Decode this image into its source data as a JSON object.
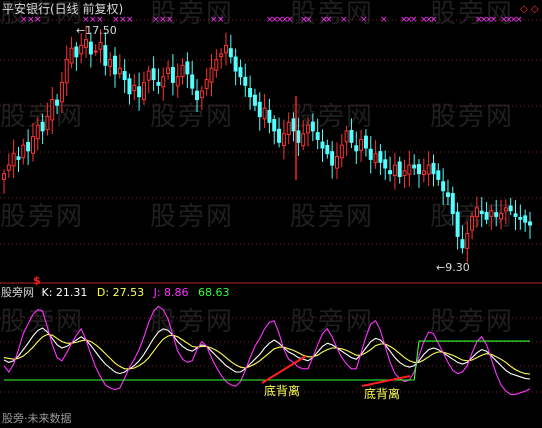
{
  "header": {
    "title": "平安银行(日线 前复权)",
    "title_color": "#d8d8d8"
  },
  "watermark": {
    "text": "股旁网",
    "color": "#3a3a3a"
  },
  "price_annotations": {
    "high": {
      "text": "17.50",
      "color": "#d8d8d8"
    },
    "low": {
      "text": "9.30",
      "color": "#d8d8d8"
    },
    "signal_marker": {
      "text": "$",
      "color": "#ff2020"
    }
  },
  "indicator": {
    "name": "股旁网",
    "k_label": "K: 21.31",
    "d_label": "D: 27.53",
    "j_label": "J: 8.86",
    "extra_label": "68.63",
    "colors": {
      "k": "#ffffff",
      "d": "#ffff55",
      "j": "#ff33ff",
      "extra": "#33ff33"
    }
  },
  "annotations": [
    {
      "text": "底背离",
      "color": "#ffff55"
    },
    {
      "text": "底背离",
      "color": "#ffff55"
    }
  ],
  "footer": {
    "text": "股旁·未来数据",
    "color": "#9a9a9a"
  },
  "chart_data": [
    {
      "type": "candlestick",
      "title": "平安银行(日线 前复权)",
      "xlabel": "",
      "ylabel": "",
      "high_label": 17.5,
      "low_label": 9.3,
      "ylim": [
        8.8,
        18.2
      ],
      "grid": true,
      "up_color": "#ff3333",
      "down_color": "#54ffff",
      "closes": [
        12.6,
        12.9,
        13.3,
        13.1,
        13.6,
        13.4,
        13.9,
        14.3,
        14.1,
        14.6,
        15.2,
        15.0,
        15.8,
        16.6,
        17.0,
        16.7,
        17.1,
        17.3,
        16.8,
        16.9,
        17.2,
        16.4,
        16.6,
        16.1,
        16.3,
        15.9,
        15.4,
        15.7,
        15.3,
        15.8,
        16.2,
        15.9,
        15.7,
        16.0,
        16.3,
        15.8,
        16.0,
        16.4,
        16.1,
        15.6,
        15.2,
        15.5,
        15.9,
        16.3,
        16.6,
        16.8,
        17.1,
        16.7,
        16.2,
        16.0,
        15.7,
        15.3,
        15.0,
        14.6,
        14.9,
        14.4,
        14.1,
        13.7,
        14.0,
        14.4,
        14.1,
        13.7,
        14.0,
        14.3,
        14.1,
        13.8,
        13.5,
        13.3,
        12.9,
        13.2,
        13.6,
        14.1,
        13.7,
        13.4,
        13.8,
        13.5,
        13.1,
        13.3,
        13.0,
        12.8,
        12.6,
        12.9,
        12.5,
        12.7,
        12.9,
        12.8,
        12.6,
        12.7,
        12.9,
        12.6,
        12.4,
        12.0,
        11.8,
        11.2,
        10.4,
        10.0,
        10.5,
        11.1,
        11.4,
        11.2,
        11.0,
        11.3,
        11.1,
        11.2,
        11.4,
        11.3,
        11.1,
        11.0,
        10.9,
        10.8
      ],
      "signal_marker_text": "$"
    },
    {
      "type": "line",
      "title": "股旁网",
      "xlabel": "",
      "ylabel": "",
      "ylim": [
        -20,
        120
      ],
      "series": [
        {
          "name": "K",
          "color": "#ffffff",
          "values": [
            45,
            42,
            44,
            50,
            58,
            66,
            75,
            82,
            85,
            80,
            72,
            64,
            60,
            62,
            66,
            70,
            74,
            70,
            63,
            55,
            47,
            40,
            35,
            30,
            28,
            30,
            34,
            38,
            44,
            52,
            62,
            72,
            80,
            84,
            82,
            76,
            68,
            62,
            58,
            56,
            60,
            64,
            62,
            56,
            50,
            44,
            38,
            34,
            30,
            30,
            34,
            40,
            46,
            52,
            60,
            66,
            70,
            66,
            60,
            55,
            52,
            48,
            46,
            44,
            48,
            55,
            62,
            66,
            64,
            60,
            56,
            52,
            48,
            46,
            52,
            60,
            68,
            72,
            70,
            64,
            56,
            48,
            42,
            38,
            36,
            38,
            44,
            52,
            58,
            60,
            58,
            54,
            50,
            46,
            42,
            40,
            42,
            48,
            54,
            58,
            56,
            50,
            44,
            38,
            32,
            28,
            26,
            24,
            22,
            21.31
          ]
        },
        {
          "name": "D",
          "color": "#ffff55",
          "values": [
            48,
            47,
            46,
            47,
            50,
            55,
            61,
            68,
            74,
            77,
            76,
            72,
            68,
            66,
            66,
            67,
            69,
            70,
            68,
            64,
            59,
            53,
            47,
            41,
            37,
            34,
            34,
            35,
            38,
            42,
            48,
            56,
            64,
            71,
            75,
            76,
            74,
            70,
            66,
            62,
            61,
            62,
            62,
            60,
            57,
            53,
            48,
            43,
            39,
            36,
            35,
            37,
            40,
            44,
            49,
            54,
            59,
            61,
            61,
            59,
            57,
            54,
            51,
            49,
            49,
            51,
            55,
            58,
            60,
            60,
            59,
            57,
            54,
            51,
            51,
            54,
            58,
            63,
            65,
            65,
            62,
            58,
            53,
            48,
            44,
            42,
            42,
            45,
            49,
            53,
            55,
            55,
            53,
            51,
            48,
            45,
            44,
            45,
            48,
            51,
            53,
            52,
            49,
            46,
            42,
            37,
            33,
            30,
            28,
            27.53
          ]
        },
        {
          "name": "J",
          "color": "#ff33ff",
          "values": [
            38,
            30,
            40,
            58,
            78,
            90,
            102,
            108,
            106,
            86,
            64,
            48,
            44,
            54,
            66,
            76,
            84,
            70,
            52,
            36,
            24,
            14,
            10,
            8,
            10,
            22,
            36,
            46,
            58,
            74,
            92,
            106,
            112,
            108,
            96,
            76,
            56,
            46,
            42,
            44,
            58,
            68,
            62,
            48,
            36,
            26,
            18,
            14,
            12,
            18,
            32,
            48,
            62,
            72,
            84,
            92,
            94,
            78,
            58,
            46,
            42,
            36,
            34,
            34,
            48,
            64,
            78,
            84,
            74,
            60,
            48,
            40,
            34,
            34,
            54,
            74,
            90,
            94,
            82,
            62,
            42,
            28,
            22,
            18,
            20,
            30,
            50,
            68,
            80,
            78,
            66,
            54,
            42,
            32,
            28,
            30,
            38,
            54,
            68,
            74,
            64,
            46,
            28,
            14,
            6,
            2,
            2,
            4,
            6,
            8.86
          ]
        },
        {
          "name": "68.63",
          "color": "#33ff33",
          "values": [
            20,
            20,
            20,
            20,
            20,
            20,
            20,
            20,
            20,
            20,
            20,
            20,
            20,
            20,
            20,
            20,
            20,
            20,
            20,
            20,
            20,
            20,
            20,
            20,
            20,
            20,
            20,
            20,
            20,
            20,
            20,
            20,
            20,
            20,
            20,
            20,
            20,
            20,
            20,
            20,
            20,
            20,
            20,
            20,
            20,
            20,
            20,
            20,
            20,
            20,
            20,
            20,
            20,
            20,
            20,
            20,
            20,
            20,
            20,
            20,
            20,
            20,
            20,
            20,
            20,
            20,
            20,
            20,
            20,
            20,
            20,
            20,
            20,
            20,
            20,
            20,
            20,
            20,
            20,
            20,
            20,
            20,
            20,
            20,
            20,
            20,
            68.63,
            68.63,
            68.63,
            68.63,
            68.63,
            68.63,
            68.63,
            68.63,
            68.63,
            68.63,
            68.63,
            68.63,
            68.63,
            68.63,
            68.63,
            68.63,
            68.63,
            68.63,
            68.63,
            68.63,
            68.63,
            68.63,
            68.63,
            68.63
          ]
        }
      ]
    }
  ]
}
